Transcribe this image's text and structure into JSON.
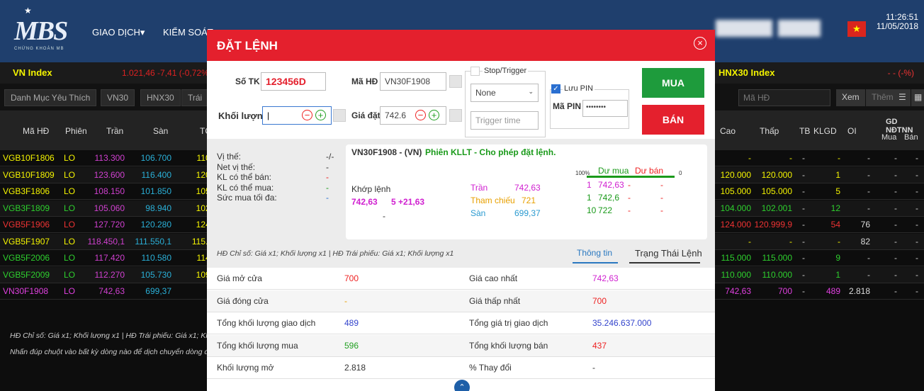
{
  "header": {
    "logo_text": "MBS",
    "logo_sub": "CHỨNG KHOÁN MB",
    "nav": [
      "GIAO DỊCH▾",
      "KIỂM SOÁT"
    ],
    "time": "11:26:51",
    "date": "11/05/2018"
  },
  "index_bar": {
    "left_label": "VN Index",
    "left_value": "1.021,46 -7,41 (-0,72%)",
    "right_label": "HNX30 Index",
    "right_value": "- - (-%)"
  },
  "tabs": [
    "Danh Mục Yêu Thích",
    "VN30",
    "HNX30",
    "Trái"
  ],
  "right_controls": {
    "search_placeholder": "Mã HĐ",
    "view_button": "Xem",
    "add_button": "Thêm"
  },
  "table": {
    "left_headers": [
      "Mã HĐ",
      "Phiên",
      "Trần",
      "Sàn",
      "TC"
    ],
    "right_headers": [
      "Cao",
      "Thấp",
      "TB",
      "KLGD",
      "OI"
    ],
    "group_header": "GD NĐTNN",
    "sub_headers": [
      "Mua",
      "Bán"
    ],
    "rows": [
      {
        "code": "VGB10F1806",
        "session": "LO",
        "ceiling": "113.300",
        "floor": "106.700",
        "ref": "110.",
        "high": "-",
        "low": "-",
        "avg": "-",
        "vol": "-",
        "oi": "-",
        "buy": "-",
        "sell": "-",
        "color": "#f5f500"
      },
      {
        "code": "VGB10F1809",
        "session": "LO",
        "ceiling": "123.600",
        "floor": "116.400",
        "ref": "120.",
        "high": "120.000",
        "low": "120.000",
        "avg": "-",
        "vol": "1",
        "oi": "-",
        "buy": "-",
        "sell": "-",
        "color": "#f5f500"
      },
      {
        "code": "VGB3F1806",
        "session": "LO",
        "ceiling": "108.150",
        "floor": "101.850",
        "ref": "105.",
        "high": "105.000",
        "low": "105.000",
        "avg": "-",
        "vol": "5",
        "oi": "-",
        "buy": "-",
        "sell": "-",
        "color": "#f5f500"
      },
      {
        "code": "VGB3F1809",
        "session": "LO",
        "ceiling": "105.060",
        "floor": "98.940",
        "ref": "102.",
        "high": "104.000",
        "low": "102.001",
        "avg": "-",
        "vol": "12",
        "oi": "-",
        "buy": "-",
        "sell": "-",
        "color": "#2ed02e"
      },
      {
        "code": "VGB5F1906",
        "session": "LO",
        "ceiling": "127.720",
        "floor": "120.280",
        "ref": "124.",
        "high": "124.000",
        "low": "120.999,9",
        "avg": "-",
        "vol": "54",
        "oi": "76",
        "buy": "-",
        "sell": "-",
        "color": "#e33"
      },
      {
        "code": "VGB5F1907",
        "session": "LO",
        "ceiling": "118.450,1",
        "floor": "111.550,1",
        "ref": "115.0",
        "high": "-",
        "low": "-",
        "avg": "-",
        "vol": "-",
        "oi": "82",
        "buy": "-",
        "sell": "-",
        "color": "#f5f500"
      },
      {
        "code": "VGB5F2006",
        "session": "LO",
        "ceiling": "117.420",
        "floor": "110.580",
        "ref": "114.",
        "high": "115.000",
        "low": "115.000",
        "avg": "-",
        "vol": "9",
        "oi": "-",
        "buy": "-",
        "sell": "-",
        "color": "#2ed02e"
      },
      {
        "code": "VGB5F2009",
        "session": "LO",
        "ceiling": "112.270",
        "floor": "105.730",
        "ref": "109.",
        "high": "110.000",
        "low": "110.000",
        "avg": "-",
        "vol": "1",
        "oi": "-",
        "buy": "-",
        "sell": "-",
        "color": "#2ed02e"
      },
      {
        "code": "VN30F1908",
        "session": "LO",
        "ceiling": "742,63",
        "floor": "699,37",
        "ref": "",
        "high": "742,63",
        "low": "700",
        "avg": "-",
        "vol": "489",
        "oi": "2.818",
        "buy": "-",
        "sell": "-",
        "color": "#e040e0"
      }
    ],
    "notes": [
      "HĐ Chỉ số: Giá x1; Khối lượng x1 | HĐ Trái phiếu: Giá x1; Khối l",
      "Nhấn đúp chuột vào bất kỳ dòng nào để dịch chuyển dòng đó"
    ]
  },
  "modal": {
    "title": "ĐẶT LỆNH",
    "account_label": "Số TK",
    "account_value": "123456D",
    "contract_label": "Mã HĐ",
    "contract_value": "VN30F1908",
    "qty_label": "Khối lượng",
    "qty_value": "",
    "price_label": "Giá đặt",
    "price_value": "742.6",
    "stop_label": "Stop/Trigger",
    "stop_select": "None",
    "trigger_placeholder": "Trigger time",
    "save_pin_label": "Lưu PIN",
    "pin_label": "Mã PIN",
    "pin_value": "••••••••",
    "buy_label": "MUA",
    "sell_label": "BÁN",
    "position": [
      {
        "label": "Vị thế:",
        "value": "-/-"
      },
      {
        "label": "Net vị thế:",
        "value": "-"
      },
      {
        "label": "KL có thể bán:",
        "value": "-"
      },
      {
        "label": "KL có thể mua:",
        "value": "-"
      },
      {
        "label": "Sức mua tối đa:",
        "value": "-"
      }
    ],
    "info_title": "VN30F1908 - (VN)",
    "info_status": "Phiên KLLT - Cho phép đặt lệnh.",
    "match_label": "Khớp lệnh",
    "match_price": "742,63",
    "match_change": "5 +21,63",
    "match_vol": "-",
    "ceiling_label": "Trần",
    "ceiling": "742,63",
    "ref_label": "Tham chiếu",
    "ref": "721",
    "floor_label": "Sàn",
    "floor": "699,37",
    "depth_pct": "100%",
    "bid_label": "Dư mua",
    "ask_label": "Dư bán",
    "depth_zero": "0",
    "depth": [
      {
        "bq": "1",
        "bp": "742,63",
        "ap": "-",
        "aq": "-"
      },
      {
        "bq": "1",
        "bp": "742,6",
        "ap": "-",
        "aq": "-"
      },
      {
        "bq": "10",
        "bp": "722",
        "ap": "-",
        "aq": "-"
      }
    ],
    "multiplier_note": "HĐ Chỉ số: Giá x1; Khối lượng x1 | HĐ Trái phiếu: Giá x1; Khối lượng x1",
    "tab_info": "Thông tin",
    "tab_status": "Trạng Thái Lệnh",
    "stats": [
      {
        "l1": "Giá mở cửa",
        "v1": "700",
        "c1": "#e22",
        "l2": "Giá cao nhất",
        "v2": "742,63",
        "c2": "#d020d0"
      },
      {
        "l1": "Giá đóng cửa",
        "v1": "-",
        "c1": "#e8a000",
        "l2": "Giá thấp nhất",
        "v2": "700",
        "c2": "#e22"
      },
      {
        "l1": "Tổng khối lượng giao dịch",
        "v1": "489",
        "c1": "#3344cc",
        "l2": "Tổng giá trị giao dịch",
        "v2": "35.246.637.000",
        "c2": "#3344cc"
      },
      {
        "l1": "Tổng khối lượng mua",
        "v1": "596",
        "c1": "#22a022",
        "l2": "Tổng khối lượng bán",
        "v2": "437",
        "c2": "#e22"
      },
      {
        "l1": "Khối lượng mở",
        "v1": "2.818",
        "c1": "#333",
        "l2": "% Thay đổi",
        "v2": "-",
        "c2": "#333"
      }
    ]
  }
}
